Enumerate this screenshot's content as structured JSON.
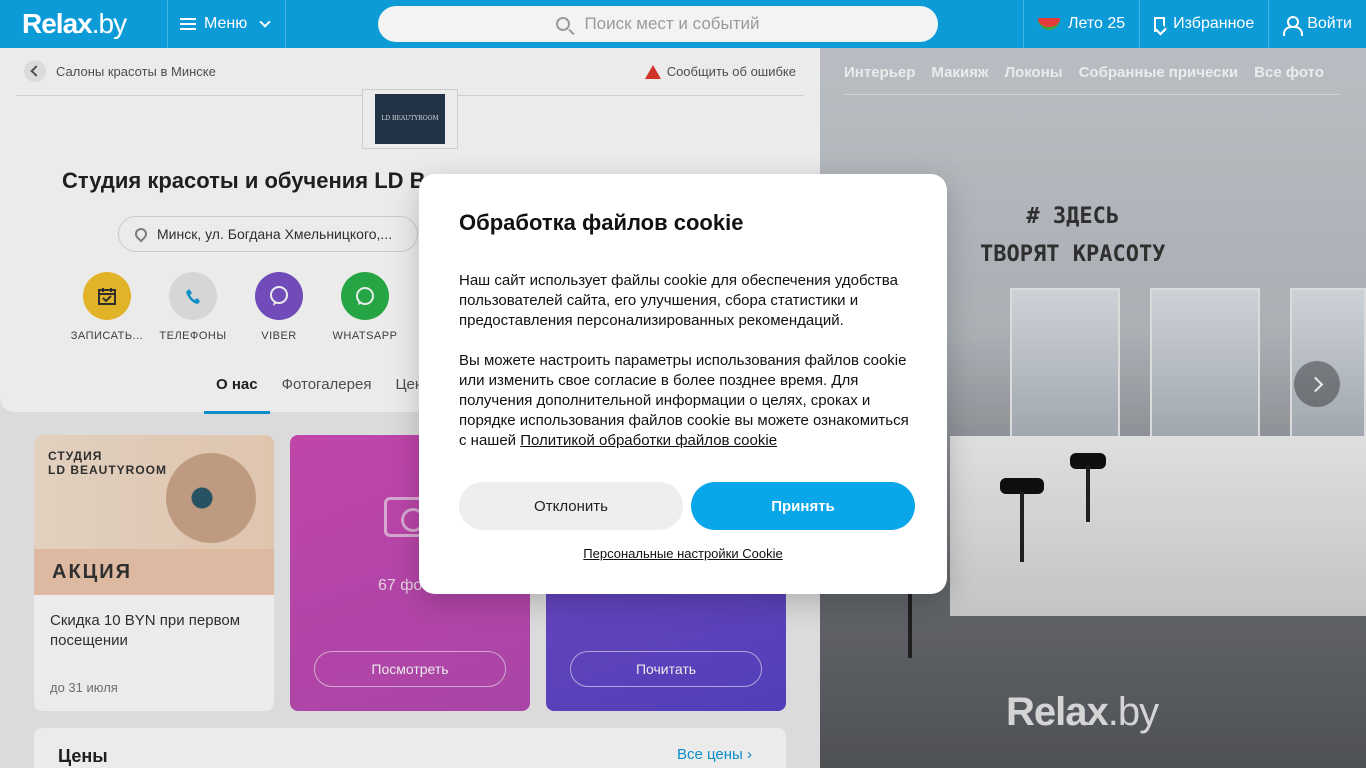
{
  "header": {
    "logo_main": "Relax",
    "logo_tld": ".by",
    "menu_label": "Меню",
    "search_placeholder": "Поиск мест и событий",
    "summer_label": "Лето 25",
    "favorites_label": "Избранное",
    "login_label": "Войти"
  },
  "page": {
    "breadcrumb": "Салоны красоты в Минске",
    "report_label": "Сообщить об ошибке",
    "salon_logo_text": "LD BEAUTYROOM",
    "title": "Студия красоты и обучения LD B",
    "address": "Минск, ул. Богдана Хмельницкого,...",
    "actions": [
      {
        "label": "ЗАПИСАТЬ...",
        "icon": "calendar-icon",
        "color": "#f5c32c"
      },
      {
        "label": "ТЕЛЕФОНЫ",
        "icon": "phone-icon",
        "color": "#e9e9e9"
      },
      {
        "label": "VIBER",
        "icon": "viber-icon",
        "color": "#7b53c9"
      },
      {
        "label": "WHATSAPP",
        "icon": "whatsapp-icon",
        "color": "#2ab34b"
      }
    ],
    "tabs": [
      "О нас",
      "Фотогалерея",
      "Цен"
    ],
    "promo": {
      "brand_line1": "СТУДИЯ",
      "brand_line2": "LD BEAUTYROOM",
      "promo_word": "АКЦИЯ",
      "text": "Скидка 10 BYN при первом посещении",
      "date": "до 31 июля"
    },
    "photos": {
      "count_label": "67 фо",
      "button": "Посмотреть"
    },
    "reviews": {
      "button": "Почитать"
    },
    "prices": {
      "title": "Цены",
      "all_link": "Все цены"
    }
  },
  "gallery": {
    "tabs": [
      "Интерьер",
      "Макияж",
      "Локоны",
      "Собранные прически",
      "Все фото"
    ],
    "wall_text_1": "# ЗДЕСЬ",
    "wall_text_2": "ТВОРЯТ КРАСОТУ",
    "watermark_main": "Relax",
    "watermark_tld": ".by"
  },
  "cookie": {
    "title": "Обработка файлов cookie",
    "para1": "Наш сайт использует файлы cookie для обеспечения удобства пользователей сайта, его улучшения, сбора статистики и предоставления персонализированных рекомендаций.",
    "para2": "Вы можете настроить параметры использования файлов cookie или изменить свое согласие в более позднее время. Для получения дополнительной информации о целях, сроках и порядке использования файлов cookie вы можете ознакомиться с нашей ",
    "policy_link": "Политикой обработки файлов cookie",
    "decline": "Отклонить",
    "accept": "Принять",
    "personal_settings": "Персональные настройки Cookie"
  },
  "colors": {
    "brand": "#0d9bd8",
    "accept": "#0aa6ea"
  }
}
